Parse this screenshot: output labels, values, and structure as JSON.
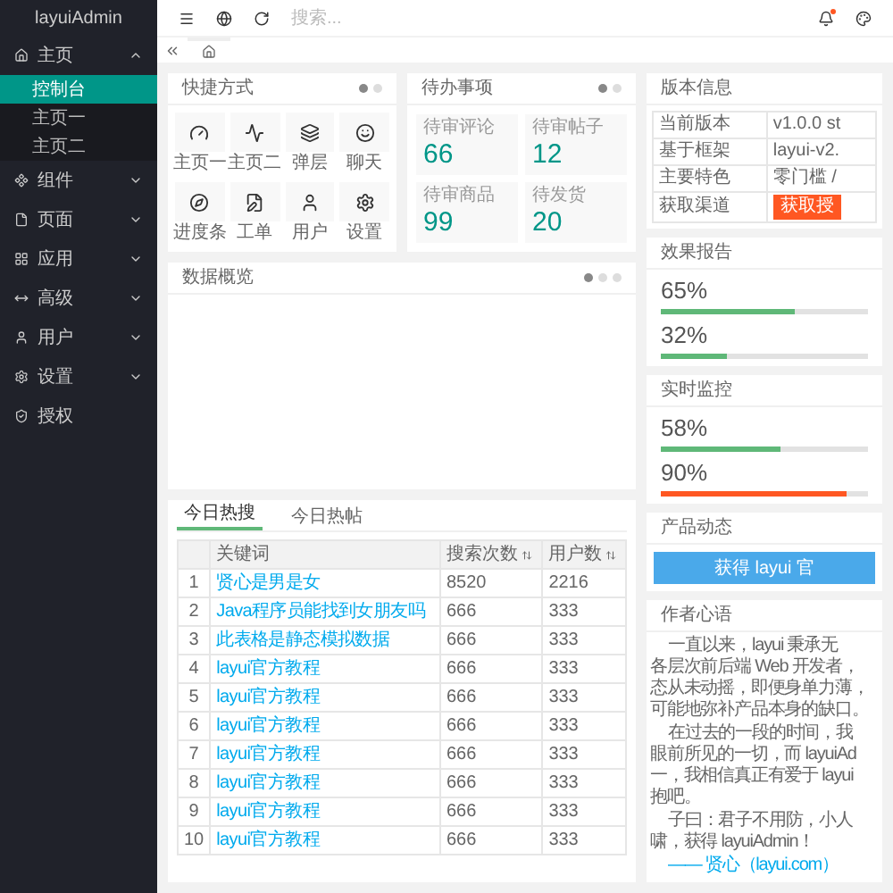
{
  "sidebar": {
    "title": "layuiAdmin",
    "items": [
      {
        "label": "主页",
        "expanded": true,
        "children": [
          {
            "label": "控制台",
            "selected": true
          },
          {
            "label": "主页一",
            "selected": false
          },
          {
            "label": "主页二",
            "selected": false
          }
        ]
      },
      {
        "label": "组件",
        "expanded": false
      },
      {
        "label": "页面",
        "expanded": false
      },
      {
        "label": "应用",
        "expanded": false
      },
      {
        "label": "高级",
        "expanded": false
      },
      {
        "label": "用户",
        "expanded": false
      },
      {
        "label": "设置",
        "expanded": false
      },
      {
        "label": "授权"
      }
    ]
  },
  "header": {
    "search": {
      "placeholder": "搜索..."
    },
    "notice_dot": true
  },
  "quick": {
    "title": "快捷方式",
    "pages": [
      {
        "selected": true
      },
      {
        "selected": false
      }
    ],
    "items": [
      "主页一",
      "主页二",
      "弹层",
      "聊天",
      "进度条",
      "工单",
      "用户",
      "设置"
    ]
  },
  "todo": {
    "title": "待办事项",
    "pages": [
      {
        "selected": true
      },
      {
        "selected": false
      }
    ],
    "items": [
      {
        "label": "待审评论",
        "value": "66"
      },
      {
        "label": "待审帖子",
        "value": "12"
      },
      {
        "label": "待审商品",
        "value": "99"
      },
      {
        "label": "待发货",
        "value": "20"
      }
    ]
  },
  "overview": {
    "title": "数据概览",
    "pages": [
      {
        "selected": true
      },
      {
        "selected": false
      },
      {
        "selected": false
      }
    ]
  },
  "hot": {
    "tabs": [
      {
        "label": "今日热搜",
        "selected": true
      },
      {
        "label": "今日热帖",
        "selected": false
      }
    ],
    "columns": [
      "",
      "关键词",
      "搜索次数",
      "用户数"
    ],
    "rows": [
      [
        "1",
        "贤心是男是女",
        "8520",
        "2216"
      ],
      [
        "2",
        "Java程序员能找到女朋友吗",
        "666",
        "333"
      ],
      [
        "3",
        "此表格是静态模拟数据",
        "666",
        "333"
      ],
      [
        "4",
        "layui官方教程",
        "666",
        "333"
      ],
      [
        "5",
        "layui官方教程",
        "666",
        "333"
      ],
      [
        "6",
        "layui官方教程",
        "666",
        "333"
      ],
      [
        "7",
        "layui官方教程",
        "666",
        "333"
      ],
      [
        "8",
        "layui官方教程",
        "666",
        "333"
      ],
      [
        "9",
        "layui官方教程",
        "666",
        "333"
      ],
      [
        "10",
        "layui官方教程",
        "666",
        "333"
      ]
    ]
  },
  "version": {
    "title": "版本信息",
    "rows": [
      {
        "label": "当前版本",
        "value": "v1.0.0 st"
      },
      {
        "label": "基于框架",
        "value": "layui-v2."
      },
      {
        "label": "主要特色",
        "value": "零门槛 /"
      },
      {
        "label": "获取渠道",
        "button": "获取授"
      }
    ]
  },
  "effect": {
    "title": "效果报告",
    "bars": [
      {
        "reading": "65%",
        "level": 0.65,
        "color": "#5fb878"
      },
      {
        "reading": "32%",
        "level": 0.32,
        "color": "#5fb878"
      }
    ]
  },
  "monitor": {
    "title": "实时监控",
    "bars": [
      {
        "reading": "58%",
        "level": 0.58,
        "color": "#5fb878"
      },
      {
        "reading": "90%",
        "level": 0.9,
        "color": "#ff5722"
      }
    ]
  },
  "product": {
    "title": "产品动态",
    "banner": "获得 layui 官"
  },
  "author": {
    "title": "作者心语",
    "paragraphs": [
      [
        "一直以来，layui 秉承无",
        "各层次前后端 Web 开发者，",
        "态从未动摇，即便身单力薄，",
        "可能地弥补产品本身的缺口。"
      ],
      [
        "在过去的一段的时间，我",
        "眼前所见的一切，而 layuiAd",
        "一，我相信真正有爱于 layui",
        "抱吧。"
      ],
      [
        "子曰：君子不用防，小人",
        "啸，获得 layuiAdmin！"
      ]
    ],
    "signature": "—— 贤心（layui.com）"
  }
}
